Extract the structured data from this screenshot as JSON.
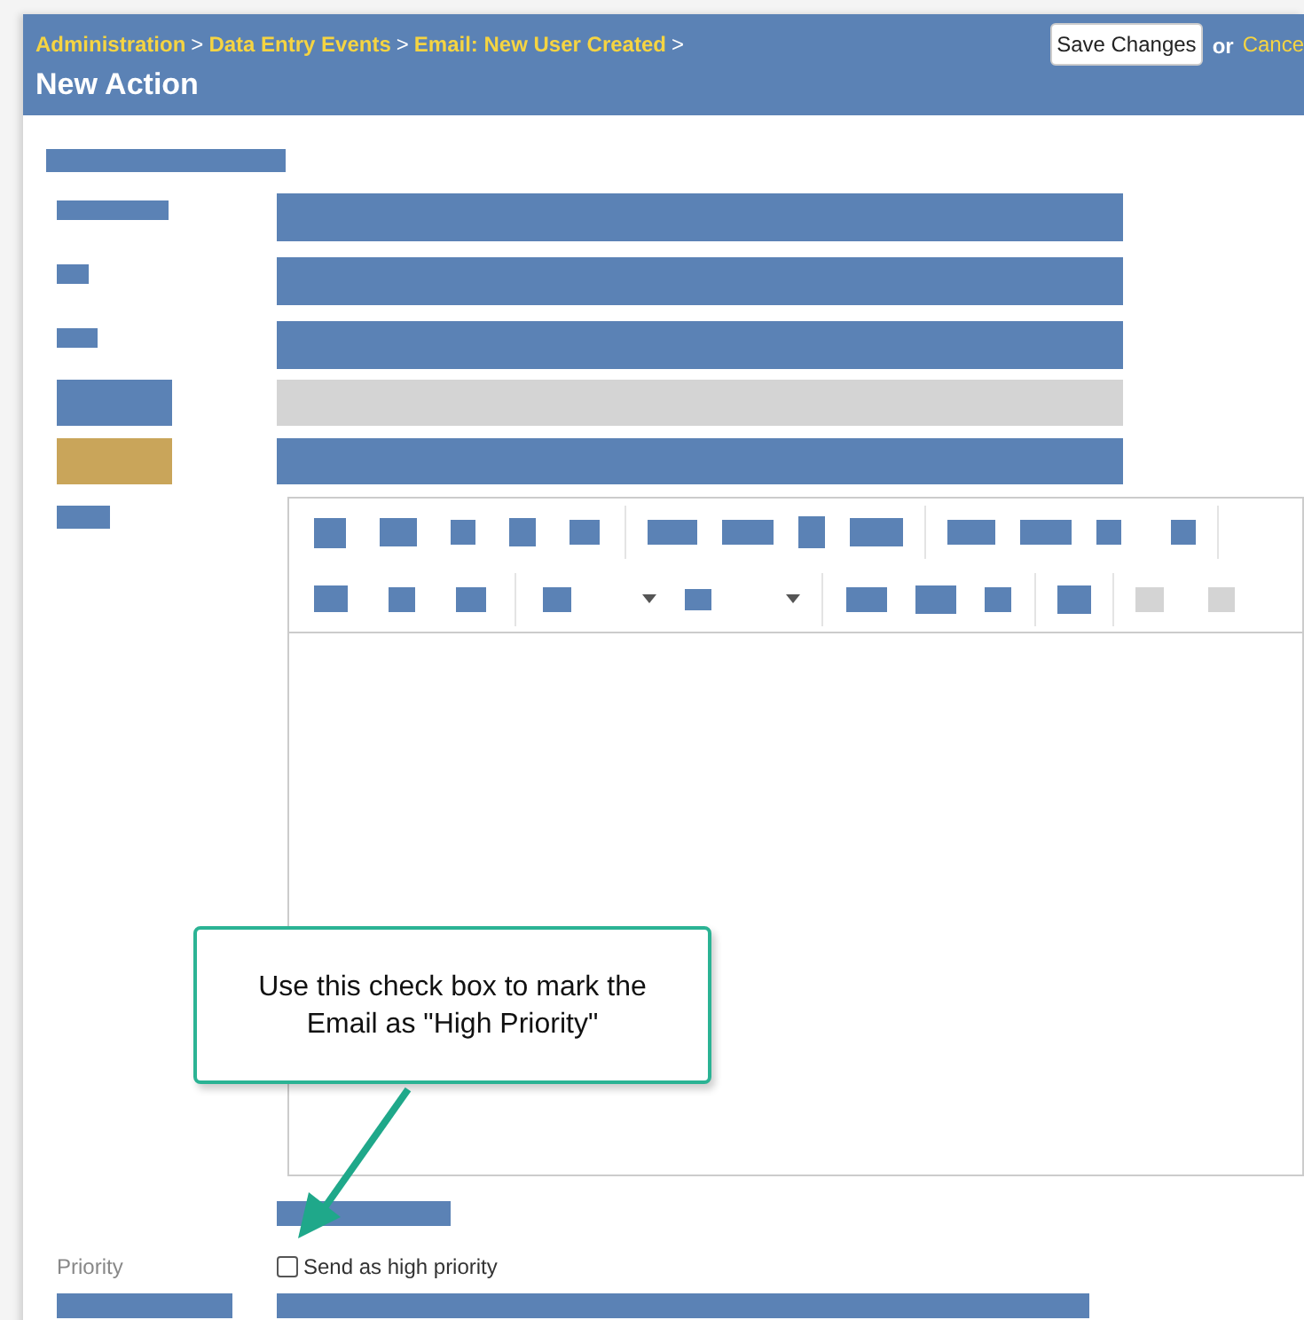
{
  "header": {
    "breadcrumbs": [
      {
        "label": "Administration",
        "separator": ">"
      },
      {
        "label": "Data Entry Events",
        "separator": ">"
      },
      {
        "label": "Email: New User Created",
        "separator": ">"
      }
    ],
    "title": "New Action",
    "save_button": "Save Changes",
    "or_text": "or",
    "cancel_link": "Cance"
  },
  "callout": {
    "text": "Use this check box to mark the Email as \"High Priority\""
  },
  "priority": {
    "label": "Priority",
    "checkbox": {
      "label": "Send as high priority",
      "checked": false
    }
  }
}
